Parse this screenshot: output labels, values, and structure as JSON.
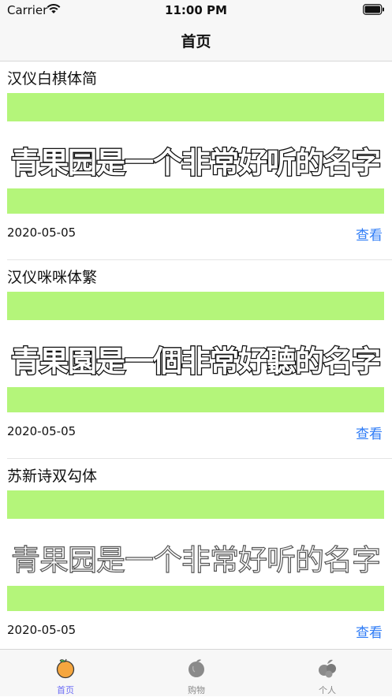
{
  "status_bar": {
    "carrier": "Carrier",
    "time": "11:00 PM"
  },
  "nav": {
    "title": "首页"
  },
  "cards": [
    {
      "title": "汉仪白棋体简",
      "preview": "青果园是一个非常好听的名字",
      "date": "2020-05-05",
      "action": "查看"
    },
    {
      "title": "汉仪咪咪体繁",
      "preview": "青果園是一個非常好聽的名字",
      "date": "2020-05-05",
      "action": "查看"
    },
    {
      "title": "苏新诗双勾体",
      "preview": "青果园是一个非常好听的名字",
      "date": "2020-05-05",
      "action": "查看"
    }
  ],
  "tab_bar": {
    "tabs": [
      {
        "label": "首页",
        "icon": "orange-fruit-icon",
        "active": true
      },
      {
        "label": "购物",
        "icon": "fruit-gray-icon",
        "active": false
      },
      {
        "label": "个人",
        "icon": "grapes-gray-icon",
        "active": false
      }
    ]
  },
  "colors": {
    "accent": "#2f7cf6",
    "preview_band": "#b4f57a",
    "tab_active": "#6b6cf6",
    "tab_inactive": "#8a8a8a"
  }
}
